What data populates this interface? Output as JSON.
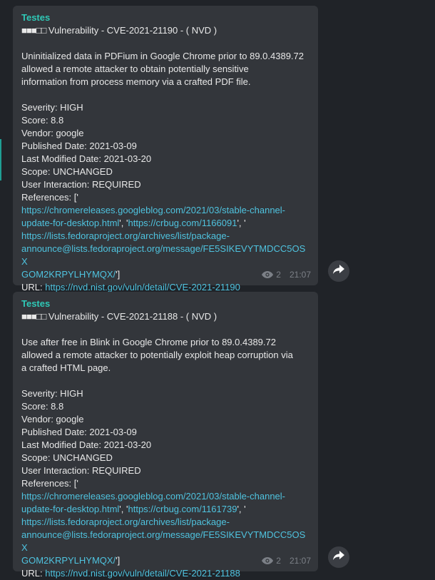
{
  "messages": [
    {
      "sender": "Testes",
      "header_blocks": "■■■□□",
      "header_text": " Vulnerability - CVE-2021-21190 - ( NVD )",
      "desc": [
        "Uninitialized data in PDFium in Google Chrome prior to 89.0.4389.72",
        "allowed a remote attacker to obtain potentially sensitive",
        "information from process memory via a crafted PDF file."
      ],
      "severity": "Severity: HIGH",
      "score": "Score: 8.8",
      "vendor": "Vendor: google",
      "published": "Published Date: 2021-03-09",
      "modified": "Last Modified Date: 2021-03-20",
      "scope": "Scope: UNCHANGED",
      "interaction": "User Interaction: REQUIRED",
      "refs_label": "References: ['",
      "ref1_a": "https://chromereleases.googleblog.com/2021/03/stable-channel-",
      "ref1_b": "update-for-desktop.html",
      "sep1": "', '",
      "ref2": "https://crbug.com/1166091",
      "sep2": "', '",
      "ref3_a": "https://lists.fedoraproject.org/archives/list/package-",
      "ref3_b": "announce@lists.fedoraproject.org/message/FE5SIKEVYTMDCC5OSX",
      "ref3_c": "GOM2KRPYLHYMQX/",
      "refs_end": "']",
      "url_label": "URL: ",
      "url": "https://nvd.nist.gov/vuln/detail/CVE-2021-21190",
      "views": "2",
      "time": "21:07"
    },
    {
      "sender": "Testes",
      "header_blocks": "■■■□□",
      "header_text": " Vulnerability - CVE-2021-21188 - ( NVD )",
      "desc": [
        "Use after free in Blink in Google Chrome prior to 89.0.4389.72",
        "allowed a remote attacker to potentially exploit heap corruption via",
        "a crafted HTML page."
      ],
      "severity": "Severity: HIGH",
      "score": "Score: 8.8",
      "vendor": "Vendor: google",
      "published": "Published Date: 2021-03-09",
      "modified": "Last Modified Date: 2021-03-20",
      "scope": "Scope: UNCHANGED",
      "interaction": "User Interaction: REQUIRED",
      "refs_label": "References: ['",
      "ref1_a": "https://chromereleases.googleblog.com/2021/03/stable-channel-",
      "ref1_b": "update-for-desktop.html",
      "sep1": "', '",
      "ref2": "https://crbug.com/1161739",
      "sep2": "', '",
      "ref3_a": "https://lists.fedoraproject.org/archives/list/package-",
      "ref3_b": "announce@lists.fedoraproject.org/message/FE5SIKEVYTMDCC5OSX",
      "ref3_c": "GOM2KRPYLHYMQX/",
      "refs_end": "']",
      "url_label": "URL: ",
      "url": "https://nvd.nist.gov/vuln/detail/CVE-2021-21188",
      "views": "2",
      "time": "21:07"
    }
  ],
  "colors": {
    "accent": "#2fc9b7",
    "link": "#4fc3df",
    "bubble": "#33363b",
    "background": "#202328"
  },
  "icons": {
    "views": "eye-icon",
    "forward": "share-arrow-icon"
  }
}
